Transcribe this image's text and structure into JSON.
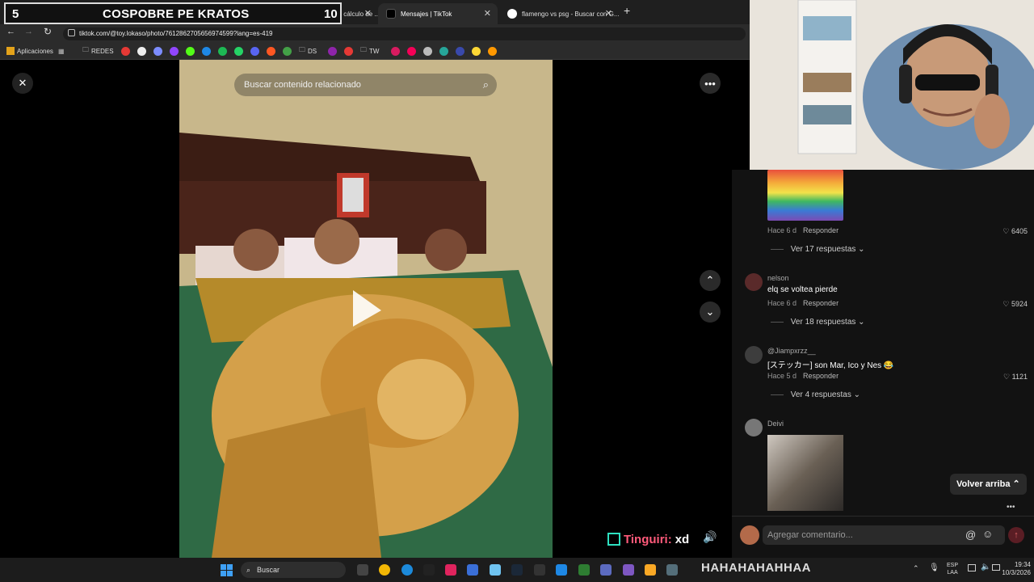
{
  "overlay": {
    "left_number": "5",
    "title": "COSPOBRE PE KRATOS",
    "right_number": "10"
  },
  "tabs": [
    {
      "label": "RULETAS - Hojas de cálculo de ..."
    },
    {
      "label": "Mensajes | TikTok"
    },
    {
      "label": "flamengo vs psg - Buscar con G..."
    }
  ],
  "address": {
    "url": "tiktok.com/@toy.lokaso/photo/7612862705656974599?lang=es-419"
  },
  "bookmarks": {
    "apps": "Aplicaciones",
    "folder1": "REDES",
    "folder2": "DS",
    "folder3": "TW"
  },
  "viewer": {
    "search_placeholder": "Buscar contenido relacionado"
  },
  "comments": [
    {
      "meta_time": "Hace 6 d",
      "reply": "Responder",
      "likes": "6405",
      "replies": "Ver 17 respuestas"
    },
    {
      "user": "nelson",
      "text": "elq se voltea pierde",
      "meta_time": "Hace 6 d",
      "reply": "Responder",
      "likes": "5924",
      "replies": "Ver 18 respuestas"
    },
    {
      "user": "@Jiampxrzz__",
      "text": "[ステッカー] son Mar, Ico y Nes 😂",
      "meta_time": "Hace 5 d",
      "reply": "Responder",
      "likes": "1121",
      "replies": "Ver 4 respuestas"
    },
    {
      "user": "Deivi"
    }
  ],
  "back_to_top": "Volver arriba",
  "comment_input_placeholder": "Agregar comentario...",
  "stream": {
    "chat_user": "Tinguiri:",
    "chat_msg": "xd",
    "ticker": "HAHAHAHAHHAA"
  },
  "taskbar": {
    "search": "Buscar",
    "lang_top": "ESP",
    "lang_bottom": "LAA",
    "time": "19:34",
    "date": "10/3/2026"
  }
}
